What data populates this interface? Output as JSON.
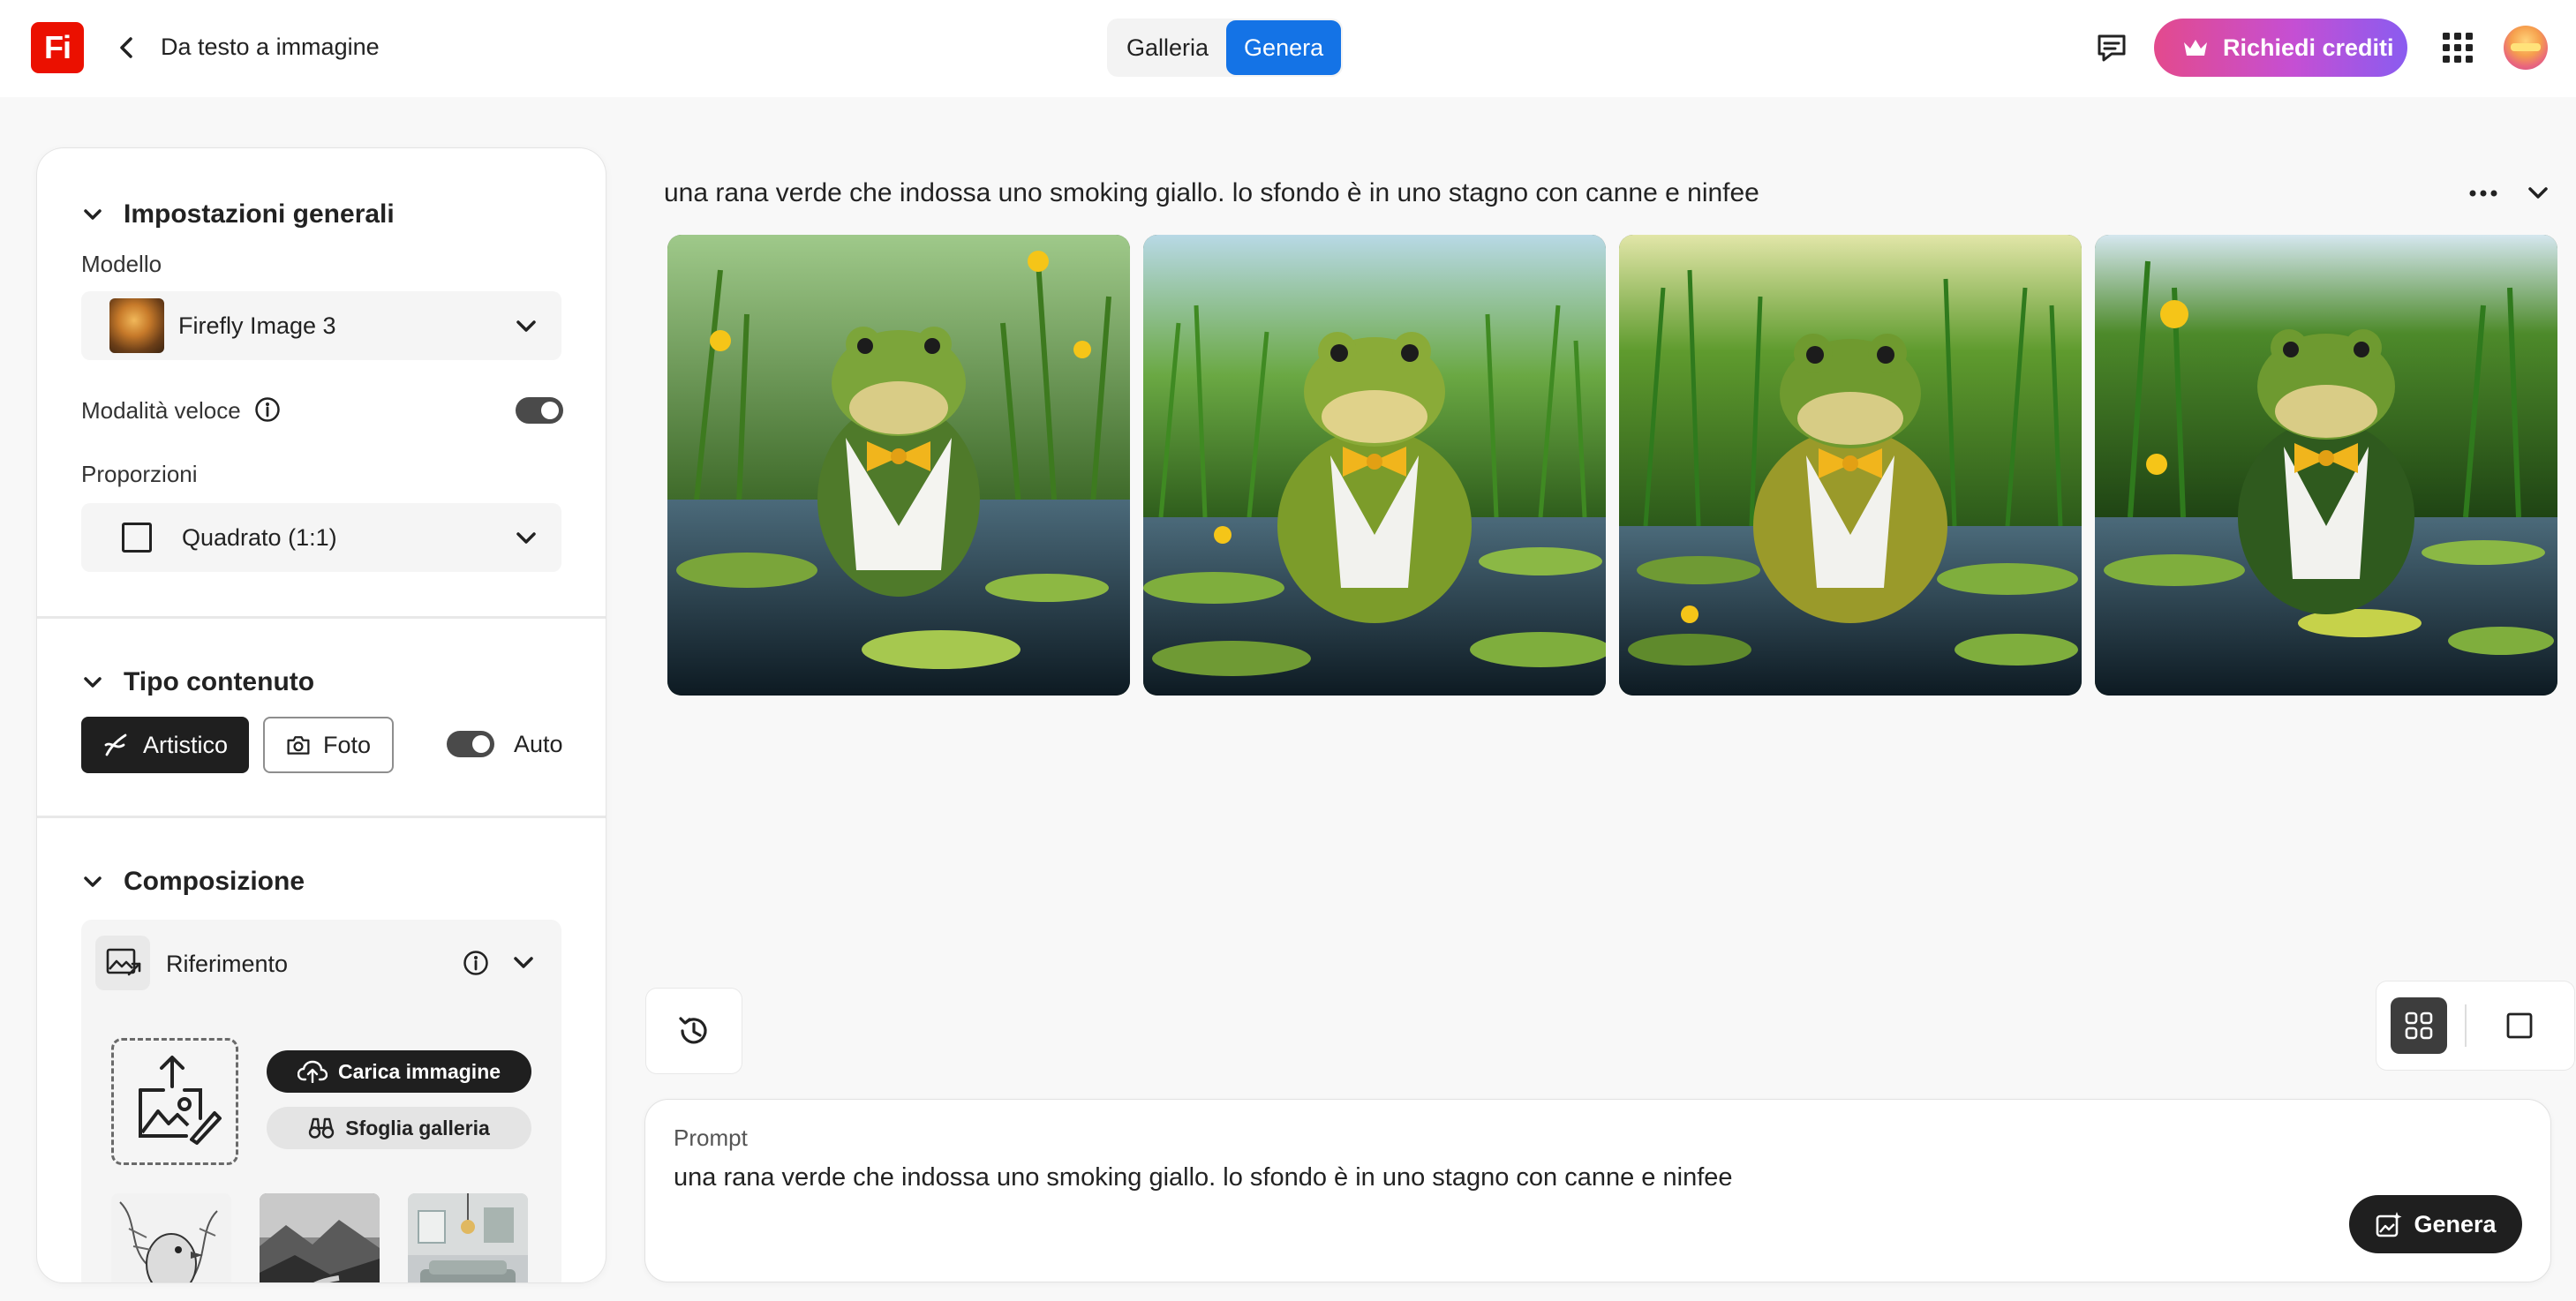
{
  "app": {
    "logo_text": "Fi",
    "page_title": "Da testo a immagine",
    "brand_color": "#eb1000",
    "accent_color": "#1473e6"
  },
  "header": {
    "tabs": [
      {
        "label": "Galleria",
        "active": false
      },
      {
        "label": "Genera",
        "active": true
      }
    ],
    "credits_label": "Richiedi crediti",
    "icons": [
      "back-icon",
      "chat-icon",
      "crown-icon",
      "apps-grid-icon",
      "avatar"
    ]
  },
  "sidebar": {
    "general": {
      "title": "Impostazioni generali",
      "model_label": "Modello",
      "model_value": "Firefly Image 3",
      "fast_mode_label": "Modalità veloce",
      "fast_mode_on": true,
      "ratio_label": "Proporzioni",
      "ratio_value": "Quadrato (1:1)"
    },
    "content_type": {
      "title": "Tipo contenuto",
      "artistic_label": "Artistico",
      "photo_label": "Foto",
      "auto_label": "Auto",
      "auto_on": true,
      "selected": "Artistico"
    },
    "composition": {
      "title": "Composizione",
      "reference_label": "Riferimento",
      "upload_label": "Carica immagine",
      "browse_label": "Sfoglia galleria"
    }
  },
  "main": {
    "prompt_heading": "una rana verde che indossa uno smoking giallo. lo sfondo è in uno stagno con canne e ninfee",
    "images": [
      {
        "name": "generated-image-1"
      },
      {
        "name": "generated-image-2"
      },
      {
        "name": "generated-image-3"
      },
      {
        "name": "generated-image-4"
      }
    ],
    "view_mode": "grid"
  },
  "prompt": {
    "label": "Prompt",
    "value": "una rana verde che indossa uno smoking giallo. lo sfondo è in uno stagno con canne e ninfee",
    "generate_label": "Genera"
  }
}
